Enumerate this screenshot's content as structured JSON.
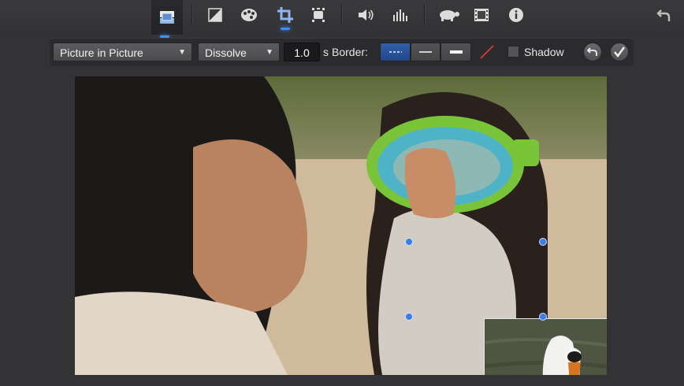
{
  "toolbar": {
    "tools": [
      {
        "name": "video-overlay-settings-icon",
        "active": true
      },
      {
        "name": "color-balance-icon",
        "active": false
      },
      {
        "name": "color-correction-icon",
        "active": false
      },
      {
        "name": "cropping-icon",
        "active": true
      },
      {
        "name": "stabilization-icon",
        "active": false
      },
      {
        "name": "volume-icon",
        "active": false
      },
      {
        "name": "noise-reduction-equalizer-icon",
        "active": false
      },
      {
        "name": "speed-icon",
        "active": false
      },
      {
        "name": "clip-filter-icon",
        "active": false
      },
      {
        "name": "clip-info-icon",
        "active": false
      }
    ],
    "reset_all_icon": "undo-arrow-icon"
  },
  "controls": {
    "overlay_type": "Picture in Picture",
    "transition": "Dissolve",
    "duration": "1.0",
    "duration_unit": "s",
    "border_label": "Border:",
    "border_options": [
      {
        "name": "border-none",
        "glyph": "---",
        "selected": true
      },
      {
        "name": "border-thin",
        "glyph": "—",
        "selected": false
      },
      {
        "name": "border-thick",
        "glyph": "▬",
        "selected": false
      }
    ],
    "shadow_label": "Shadow",
    "shadow_checked": false
  },
  "colors": {
    "accent": "#3d8fff",
    "segment_selected": "#2f5ea8",
    "handle": "#3a7ee6",
    "no_color": "#d23a3a"
  }
}
